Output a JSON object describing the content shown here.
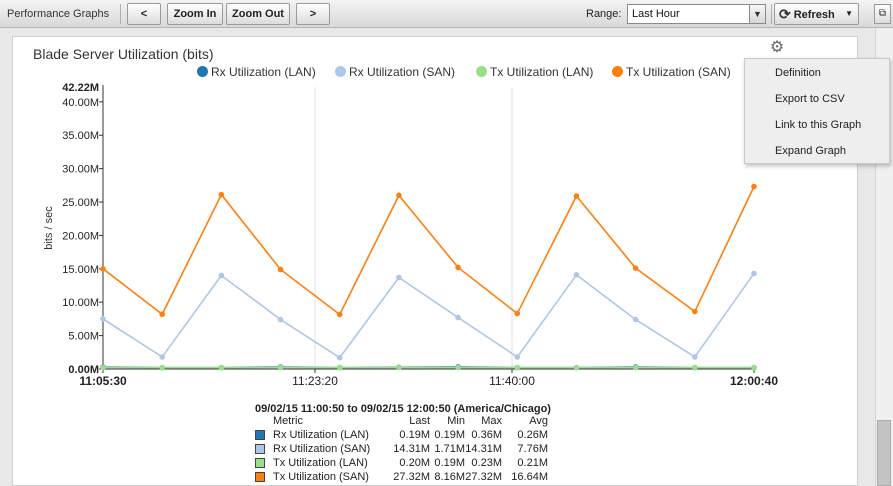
{
  "toolbar": {
    "title": "Performance Graphs",
    "prev_label": "<",
    "zoom_in_label": "Zoom In",
    "zoom_out_label": "Zoom Out",
    "next_label": ">",
    "range_label": "Range:",
    "range_value": "Last Hour",
    "refresh_label": "Refresh",
    "refresh_icon": "refresh-icon",
    "dropdown_icon": "chevron-down-icon",
    "expand_icon": "window-icon"
  },
  "panel": {
    "title": "Blade Server Utilization (bits)",
    "settings_icon": "gear-icon"
  },
  "menu": {
    "items": [
      "Definition",
      "Export to CSV",
      "Link to this Graph",
      "Expand Graph"
    ]
  },
  "colors": {
    "rx_lan": "#1f77b4",
    "rx_san": "#aec7e8",
    "tx_lan": "#98df8a",
    "tx_san": "#ff7f0e"
  },
  "chart_data": {
    "type": "line",
    "ylabel": "bits / sec",
    "y_max_label": "42.22M",
    "ylim": [
      0,
      42.22
    ],
    "y_unit": "M",
    "y_ticks": [
      "0.00M",
      "5.00M",
      "10.00M",
      "15.00M",
      "20.00M",
      "25.00M",
      "30.00M",
      "35.00M",
      "40.00M"
    ],
    "x_ticks": [
      "11:05:30",
      "11:23:20",
      "11:40:00",
      "12:00:40"
    ],
    "grid": true,
    "legend_position": "top",
    "series": [
      {
        "name": "Rx Utilization (LAN)",
        "values": [
          0.3,
          0.2,
          0.2,
          0.3,
          0.2,
          0.25,
          0.3,
          0.2,
          0.2,
          0.3,
          0.2,
          0.19
        ]
      },
      {
        "name": "Rx Utilization (SAN)",
        "values": [
          7.5,
          1.8,
          14.0,
          7.4,
          1.7,
          13.7,
          7.7,
          1.8,
          14.1,
          7.4,
          1.8,
          14.31
        ]
      },
      {
        "name": "Tx Utilization (LAN)",
        "values": [
          0.23,
          0.2,
          0.2,
          0.21,
          0.19,
          0.21,
          0.2,
          0.2,
          0.2,
          0.21,
          0.2,
          0.2
        ]
      },
      {
        "name": "Tx Utilization (SAN)",
        "values": [
          15.0,
          8.2,
          26.1,
          14.9,
          8.16,
          26.0,
          15.2,
          8.3,
          25.9,
          15.1,
          8.6,
          27.32
        ]
      }
    ]
  },
  "summary": {
    "heading": "09/02/15 11:00:50 to 09/02/15 12:00:50 (America/Chicago)",
    "columns": [
      "Metric",
      "Last",
      "Min",
      "Max",
      "Avg"
    ],
    "rows": [
      {
        "metric": "Rx Utilization (LAN)",
        "last": "0.19M",
        "min": "0.19M",
        "max": "0.36M",
        "avg": "0.26M"
      },
      {
        "metric": "Rx Utilization (SAN)",
        "last": "14.31M",
        "min": "1.71M",
        "max": "14.31M",
        "avg": "7.76M"
      },
      {
        "metric": "Tx Utilization (LAN)",
        "last": "0.20M",
        "min": "0.19M",
        "max": "0.23M",
        "avg": "0.21M"
      },
      {
        "metric": "Tx Utilization (SAN)",
        "last": "27.32M",
        "min": "8.16M",
        "max": "27.32M",
        "avg": "16.64M"
      }
    ]
  }
}
